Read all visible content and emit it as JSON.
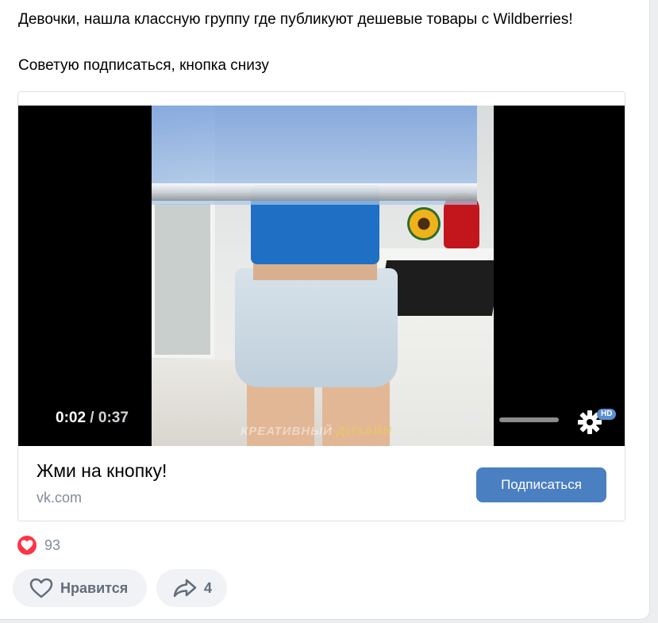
{
  "post": {
    "text_line1": "Девочки, нашла классную группу где публикуют дешевые товары с Wildberries!",
    "text_line2": "Советую подписаться, кнопка снизу"
  },
  "video": {
    "current_time": "0:02",
    "separator": " / ",
    "duration": "0:37",
    "quality_badge": "HD",
    "watermark_part1": "КРЕАТИВНЫЙ ",
    "watermark_part2": "ДИЗАЙН",
    "muted": true
  },
  "card": {
    "title": "Жми на кнопку!",
    "domain": "vk.com",
    "button_label": "Подписаться",
    "button_color": "#4a7fc1"
  },
  "reactions": {
    "icon": "heart-icon",
    "count": "93"
  },
  "actions": {
    "like_label": "Нравится",
    "like_icon": "heart-outline-icon",
    "share_count": "4",
    "share_icon": "share-arrow-icon"
  }
}
